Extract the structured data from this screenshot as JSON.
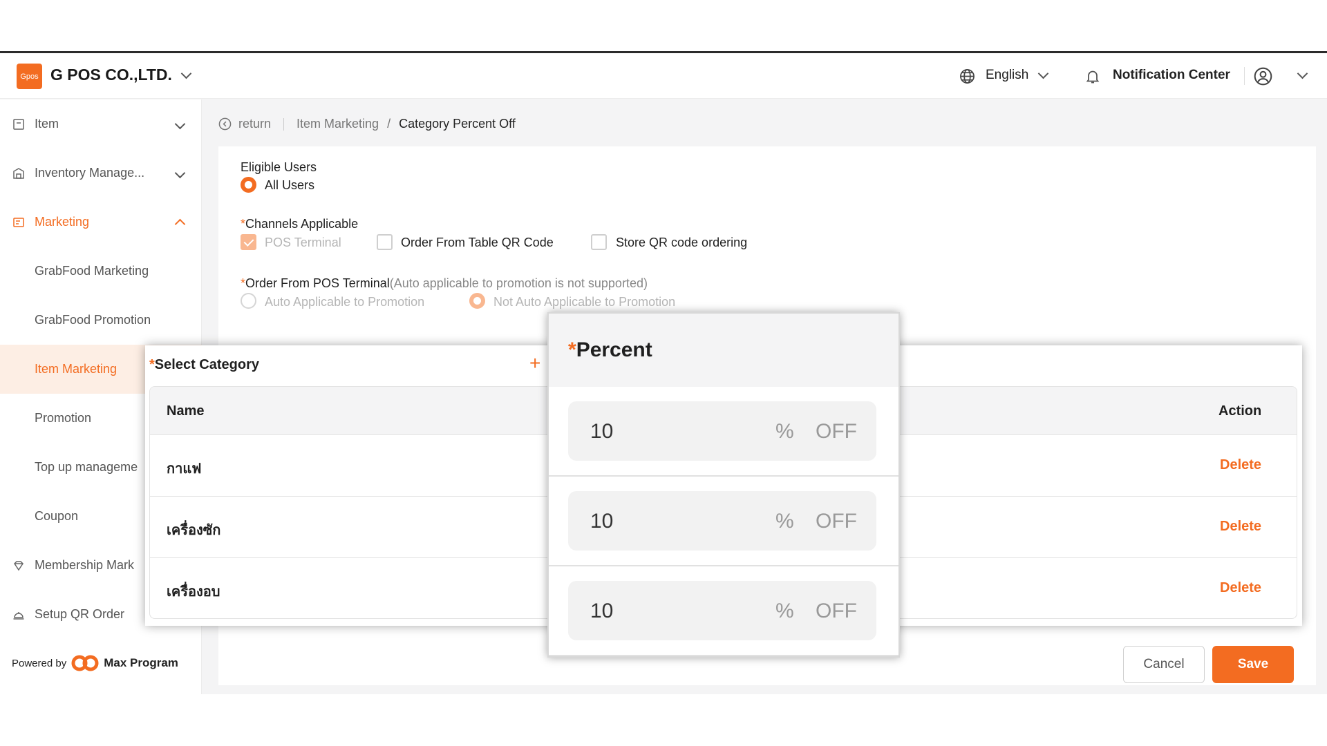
{
  "header": {
    "logo_text": "Gpos",
    "company": "G POS CO.,LTD.",
    "language": "English",
    "notification": "Notification Center"
  },
  "sidebar": {
    "items": [
      {
        "label": "Item"
      },
      {
        "label": "Inventory Manage..."
      },
      {
        "label": "Marketing"
      },
      {
        "label": "GrabFood Marketing"
      },
      {
        "label": "GrabFood Promotion"
      },
      {
        "label": "Item Marketing"
      },
      {
        "label": "Promotion"
      },
      {
        "label": "Top up manageme"
      },
      {
        "label": "Coupon"
      },
      {
        "label": "Membership Mark"
      },
      {
        "label": "Setup QR Order"
      }
    ],
    "powered_by": "Powered by",
    "powered_brand": "Max Program"
  },
  "breadcrumb": {
    "back": "return",
    "parent": "Item Marketing",
    "separator": "/",
    "current": "Category Percent Off"
  },
  "form": {
    "eligible_users_label": "Eligible Users",
    "all_users": "All Users",
    "required_mark": "*",
    "channels_label": "Channels Applicable",
    "channels": [
      "POS Terminal",
      "Order From Table QR Code",
      "Store QR code ordering"
    ],
    "pos_order_label": "Order From POS Terminal",
    "pos_order_note": "(Auto applicable to promotion is not supported)",
    "auto_applicable": "Auto Applicable to Promotion",
    "not_auto_applicable": "Not Auto Applicable to Promotion"
  },
  "category": {
    "title": "Select Category",
    "add_icon": "+",
    "col_name": "Name",
    "col_action": "Action",
    "rows": [
      {
        "name": "กาแฟ",
        "action": "Delete"
      },
      {
        "name": "เครื่องซัก",
        "action": "Delete"
      },
      {
        "name": "เครื่องอบ",
        "action": "Delete"
      }
    ]
  },
  "percent": {
    "title": "Percent",
    "rows": [
      {
        "value": "10",
        "unit": "%",
        "suffix": "OFF"
      },
      {
        "value": "10",
        "unit": "%",
        "suffix": "OFF"
      },
      {
        "value": "10",
        "unit": "%",
        "suffix": "OFF"
      }
    ]
  },
  "actions": {
    "cancel": "Cancel",
    "save": "Save"
  },
  "colors": {
    "accent": "#f36c21",
    "accent_light": "#fdeee4"
  }
}
